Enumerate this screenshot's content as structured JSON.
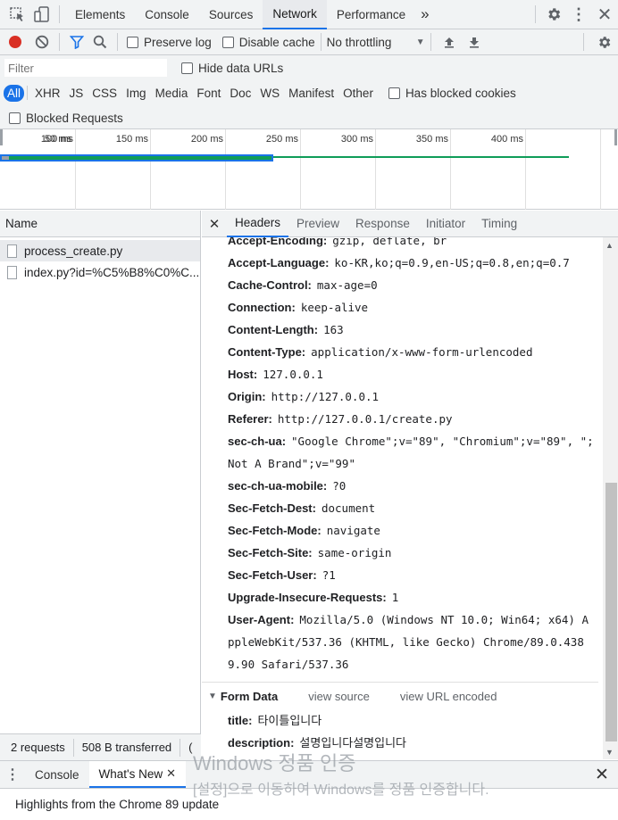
{
  "main_tabs": [
    "Elements",
    "Console",
    "Sources",
    "Network",
    "Performance"
  ],
  "more_tabs_label": "»",
  "toolbar": {
    "preserve_log": "Preserve log",
    "disable_cache": "Disable cache",
    "throttling": "No throttling"
  },
  "filter": {
    "placeholder": "Filter",
    "hide_data_urls": "Hide data URLs",
    "types": [
      "All",
      "XHR",
      "JS",
      "CSS",
      "Img",
      "Media",
      "Font",
      "Doc",
      "WS",
      "Manifest",
      "Other"
    ],
    "has_blocked_cookies": "Has blocked cookies",
    "blocked_requests": "Blocked Requests"
  },
  "timeline": {
    "ticks": [
      "50 ms",
      "100 ms",
      "150 ms",
      "200 ms",
      "250 ms",
      "300 ms",
      "350 ms",
      "400 ms"
    ]
  },
  "requests": {
    "header": "Name",
    "items": [
      "process_create.py",
      "index.py?id=%C5%B8%C0%C..."
    ],
    "status": "2 requests",
    "transferred": "508 B transferred",
    "more": "("
  },
  "detail_tabs": [
    "Headers",
    "Preview",
    "Response",
    "Initiator",
    "Timing"
  ],
  "headers": [
    {
      "k": "Accept-Encoding:",
      "v": "gzip, deflate, br"
    },
    {
      "k": "Accept-Language:",
      "v": "ko-KR,ko;q=0.9,en-US;q=0.8,en;q=0.7"
    },
    {
      "k": "Cache-Control:",
      "v": "max-age=0"
    },
    {
      "k": "Connection:",
      "v": "keep-alive"
    },
    {
      "k": "Content-Length:",
      "v": "163"
    },
    {
      "k": "Content-Type:",
      "v": "application/x-www-form-urlencoded"
    },
    {
      "k": "Host:",
      "v": "127.0.0.1"
    },
    {
      "k": "Origin:",
      "v": "http://127.0.0.1"
    },
    {
      "k": "Referer:",
      "v": "http://127.0.0.1/create.py"
    },
    {
      "k": "sec-ch-ua:",
      "v": "\"Google Chrome\";v=\"89\", \"Chromium\";v=\"89\", \";Not A Brand\";v=\"99\""
    },
    {
      "k": "sec-ch-ua-mobile:",
      "v": "?0"
    },
    {
      "k": "Sec-Fetch-Dest:",
      "v": "document"
    },
    {
      "k": "Sec-Fetch-Mode:",
      "v": "navigate"
    },
    {
      "k": "Sec-Fetch-Site:",
      "v": "same-origin"
    },
    {
      "k": "Sec-Fetch-User:",
      "v": "?1"
    },
    {
      "k": "Upgrade-Insecure-Requests:",
      "v": "1"
    },
    {
      "k": "User-Agent:",
      "v": "Mozilla/5.0 (Windows NT 10.0; Win64; x64) AppleWebKit/537.36 (KHTML, like Gecko) Chrome/89.0.4389.90 Safari/537.36"
    }
  ],
  "form_data": {
    "title": "Form Data",
    "view_source": "view source",
    "view_url_encoded": "view URL encoded",
    "fields": [
      {
        "k": "title:",
        "v": "타이틀입니다"
      },
      {
        "k": "description:",
        "v": "설명입니다설명입니다"
      }
    ]
  },
  "drawer": {
    "tabs": [
      "Console",
      "What's New"
    ],
    "message": "Highlights from the Chrome 89 update"
  },
  "watermark": {
    "line1": "Windows 정품 인증",
    "line2": "[설정]으로 이동하여 Windows를 정품 인증합니다."
  },
  "colors": {
    "accent": "#1a73e8",
    "record": "#d93025",
    "bar_green": "#0f9d58"
  }
}
